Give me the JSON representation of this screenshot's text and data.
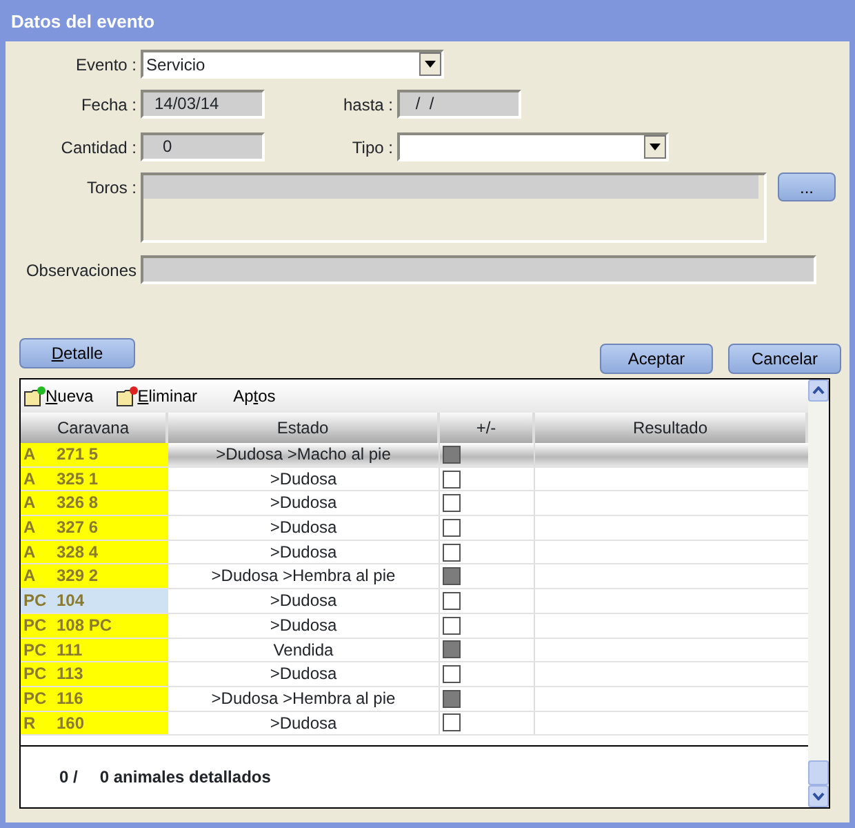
{
  "window": {
    "title": "Datos del evento"
  },
  "form": {
    "evento": {
      "label": "Evento :",
      "value": "Servicio"
    },
    "fecha": {
      "label": "Fecha :",
      "value": "14/03/14"
    },
    "hasta": {
      "label": "hasta :",
      "value": " /  /"
    },
    "cantidad": {
      "label": "Cantidad :",
      "value": "0"
    },
    "tipo": {
      "label": "Tipo :"
    },
    "toros": {
      "label": "Toros :",
      "button": "..."
    },
    "observaciones": {
      "label": "Observaciones"
    }
  },
  "buttons": {
    "detalle": "Detalle",
    "aceptar": "Aceptar",
    "cancelar": "Cancelar"
  },
  "toolbar": [
    {
      "label": "Nueva",
      "kind": "add"
    },
    {
      "label": "Eliminar",
      "kind": "delete"
    },
    {
      "label": "Aptos",
      "kind": "text"
    }
  ],
  "table": {
    "columns": [
      "Caravana",
      "Estado",
      "+/-",
      "Resultado"
    ],
    "rows": [
      {
        "prefix": "A",
        "number": "271 5",
        "estado": ">Dudosa >Macho al pie",
        "checked": true,
        "selected": true,
        "color": "#ffff00"
      },
      {
        "prefix": "A",
        "number": "325 1",
        "estado": ">Dudosa",
        "checked": false,
        "selected": false,
        "color": "#ffff00"
      },
      {
        "prefix": "A",
        "number": "326 8",
        "estado": ">Dudosa",
        "checked": false,
        "selected": false,
        "color": "#ffff00"
      },
      {
        "prefix": "A",
        "number": "327 6",
        "estado": ">Dudosa",
        "checked": false,
        "selected": false,
        "color": "#ffff00"
      },
      {
        "prefix": "A",
        "number": "328 4",
        "estado": ">Dudosa",
        "checked": false,
        "selected": false,
        "color": "#ffff00"
      },
      {
        "prefix": "A",
        "number": "329 2",
        "estado": ">Dudosa >Hembra al pie",
        "checked": true,
        "selected": false,
        "color": "#ffff00"
      },
      {
        "prefix": "PC",
        "number": "104",
        "estado": ">Dudosa",
        "checked": false,
        "selected": false,
        "color": "#cfe2f3"
      },
      {
        "prefix": "PC",
        "number": "108 PC",
        "estado": ">Dudosa",
        "checked": false,
        "selected": false,
        "color": "#ffff00"
      },
      {
        "prefix": "PC",
        "number": "111",
        "estado": "Vendida",
        "checked": true,
        "selected": false,
        "color": "#ffff00"
      },
      {
        "prefix": "PC",
        "number": "113",
        "estado": ">Dudosa",
        "checked": false,
        "selected": false,
        "color": "#ffff00"
      },
      {
        "prefix": "PC",
        "number": "116",
        "estado": ">Dudosa >Hembra al pie",
        "checked": true,
        "selected": false,
        "color": "#ffff00"
      },
      {
        "prefix": "R",
        "number": "160",
        "estado": ">Dudosa",
        "checked": false,
        "selected": false,
        "color": "#ffff00"
      }
    ]
  },
  "footer": {
    "count": "0 /",
    "text": "0 animales detallados"
  }
}
